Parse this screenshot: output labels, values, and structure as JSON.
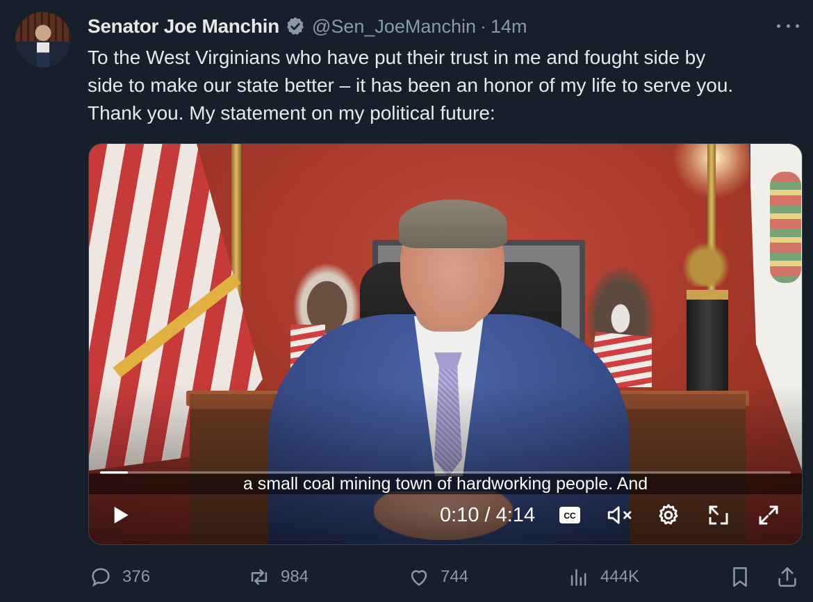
{
  "author": {
    "name": "Senator Joe Manchin",
    "handle": "@Sen_JoeManchin",
    "separator": "·",
    "time": "14m"
  },
  "tweet": {
    "lines": [
      "To the West Virginians who have put their trust in me and fought side by",
      "side to make our state better – it has been an honor of my life to serve you.",
      "Thank you. My statement on my political future:"
    ]
  },
  "video": {
    "caption": "a small coal mining town of hardworking people. And",
    "timecode": "0:10 / 4:14",
    "cc_label": "CC",
    "progress_fraction": 0.04
  },
  "actions": {
    "replies": "376",
    "reposts": "984",
    "likes": "744",
    "views": "444K"
  },
  "colors": {
    "background": "#15202b",
    "text": "#e7e9ea",
    "secondary": "#8b98a5",
    "verified": "#8b98a5"
  },
  "icons": [
    "verified-badge-icon",
    "more-icon",
    "play-icon",
    "cc-icon",
    "mute-icon",
    "settings-icon",
    "pip-icon",
    "fullscreen-icon",
    "reply-icon",
    "repost-icon",
    "like-icon",
    "views-icon",
    "bookmark-icon",
    "share-icon"
  ]
}
